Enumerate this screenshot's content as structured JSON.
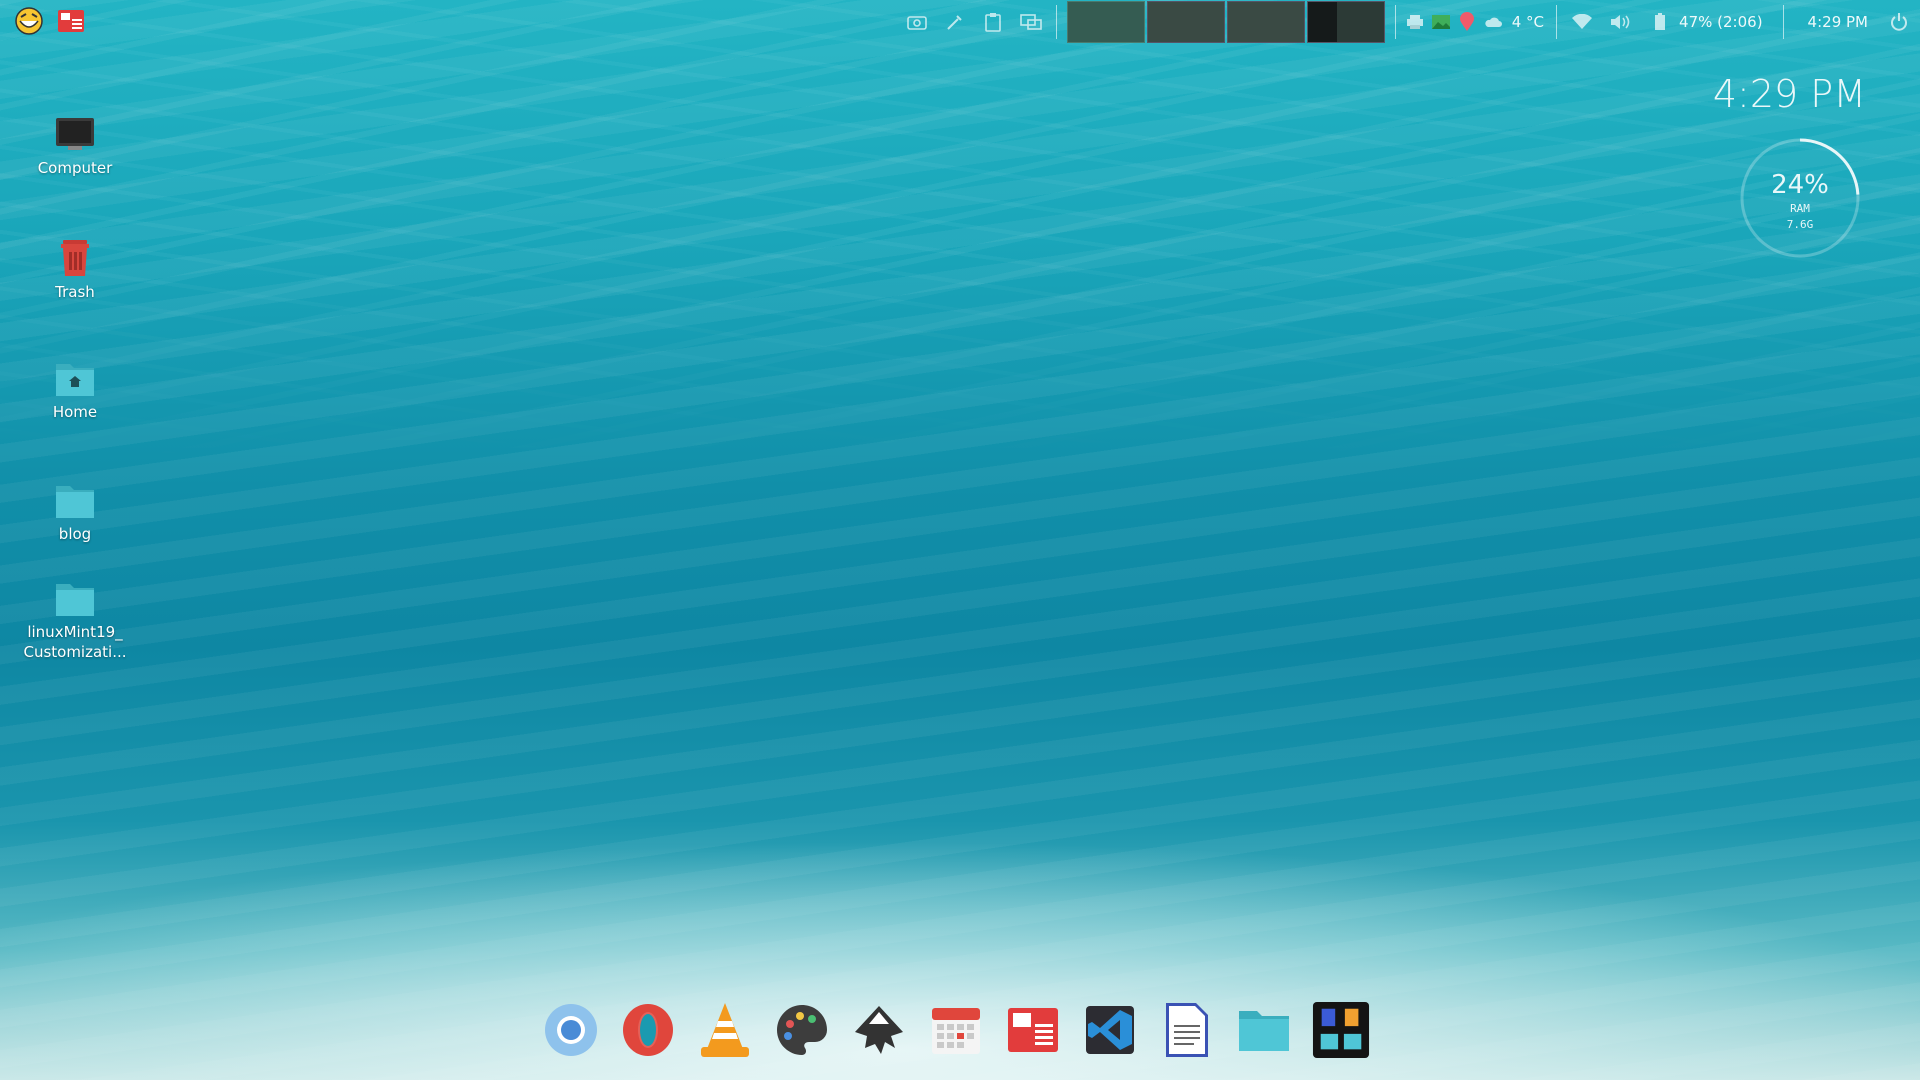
{
  "desktop": {
    "icons": [
      {
        "label": "Computer",
        "icon": "computer-icon"
      },
      {
        "label": "Trash",
        "icon": "trash-icon"
      },
      {
        "label": "Home",
        "icon": "home-folder-icon"
      },
      {
        "label": "blog",
        "icon": "folder-icon"
      },
      {
        "label": "linuxMint19_\nCustomizati...",
        "icon": "folder-icon"
      }
    ]
  },
  "panel": {
    "left_icons": [
      "menu-smiley-icon",
      "news-reader-icon"
    ],
    "tray_icons_left": [
      "screenshot-icon",
      "color-picker-icon",
      "clipboard-icon",
      "display-icon"
    ],
    "workspaces": [
      {
        "name": "workspace-1",
        "active": true
      },
      {
        "name": "workspace-2",
        "active": false
      },
      {
        "name": "workspace-3",
        "active": false
      },
      {
        "name": "workspace-4",
        "active": false
      }
    ],
    "weather": "4 °C",
    "battery": "47% (2:06)",
    "clock": "4:29 PM",
    "tray_icons_right": [
      "printer-icon",
      "image-viewer-icon",
      "location-pin-icon",
      "cloud-icon",
      "wifi-icon",
      "volume-icon",
      "battery-icon",
      "power-icon"
    ]
  },
  "conky": {
    "time": "4:29 PM",
    "ram_percent": "24%",
    "ram_label": "RAM",
    "ram_total": "7.6G",
    "ram_fraction": 0.24
  },
  "dock": {
    "apps": [
      "chromium-icon",
      "opera-icon",
      "vlc-icon",
      "paint-palette-icon",
      "inkscape-icon",
      "calendar-icon",
      "news-app-icon",
      "vscode-icon",
      "text-document-icon",
      "files-folder-icon",
      "libreoffice-launcher-icon"
    ]
  },
  "colors": {
    "water_top": "#23b4c4",
    "water_mid": "#0e87a3",
    "sand": "#c8e6e6",
    "folder": "#4fc6d6",
    "trash": "#d9463e"
  }
}
